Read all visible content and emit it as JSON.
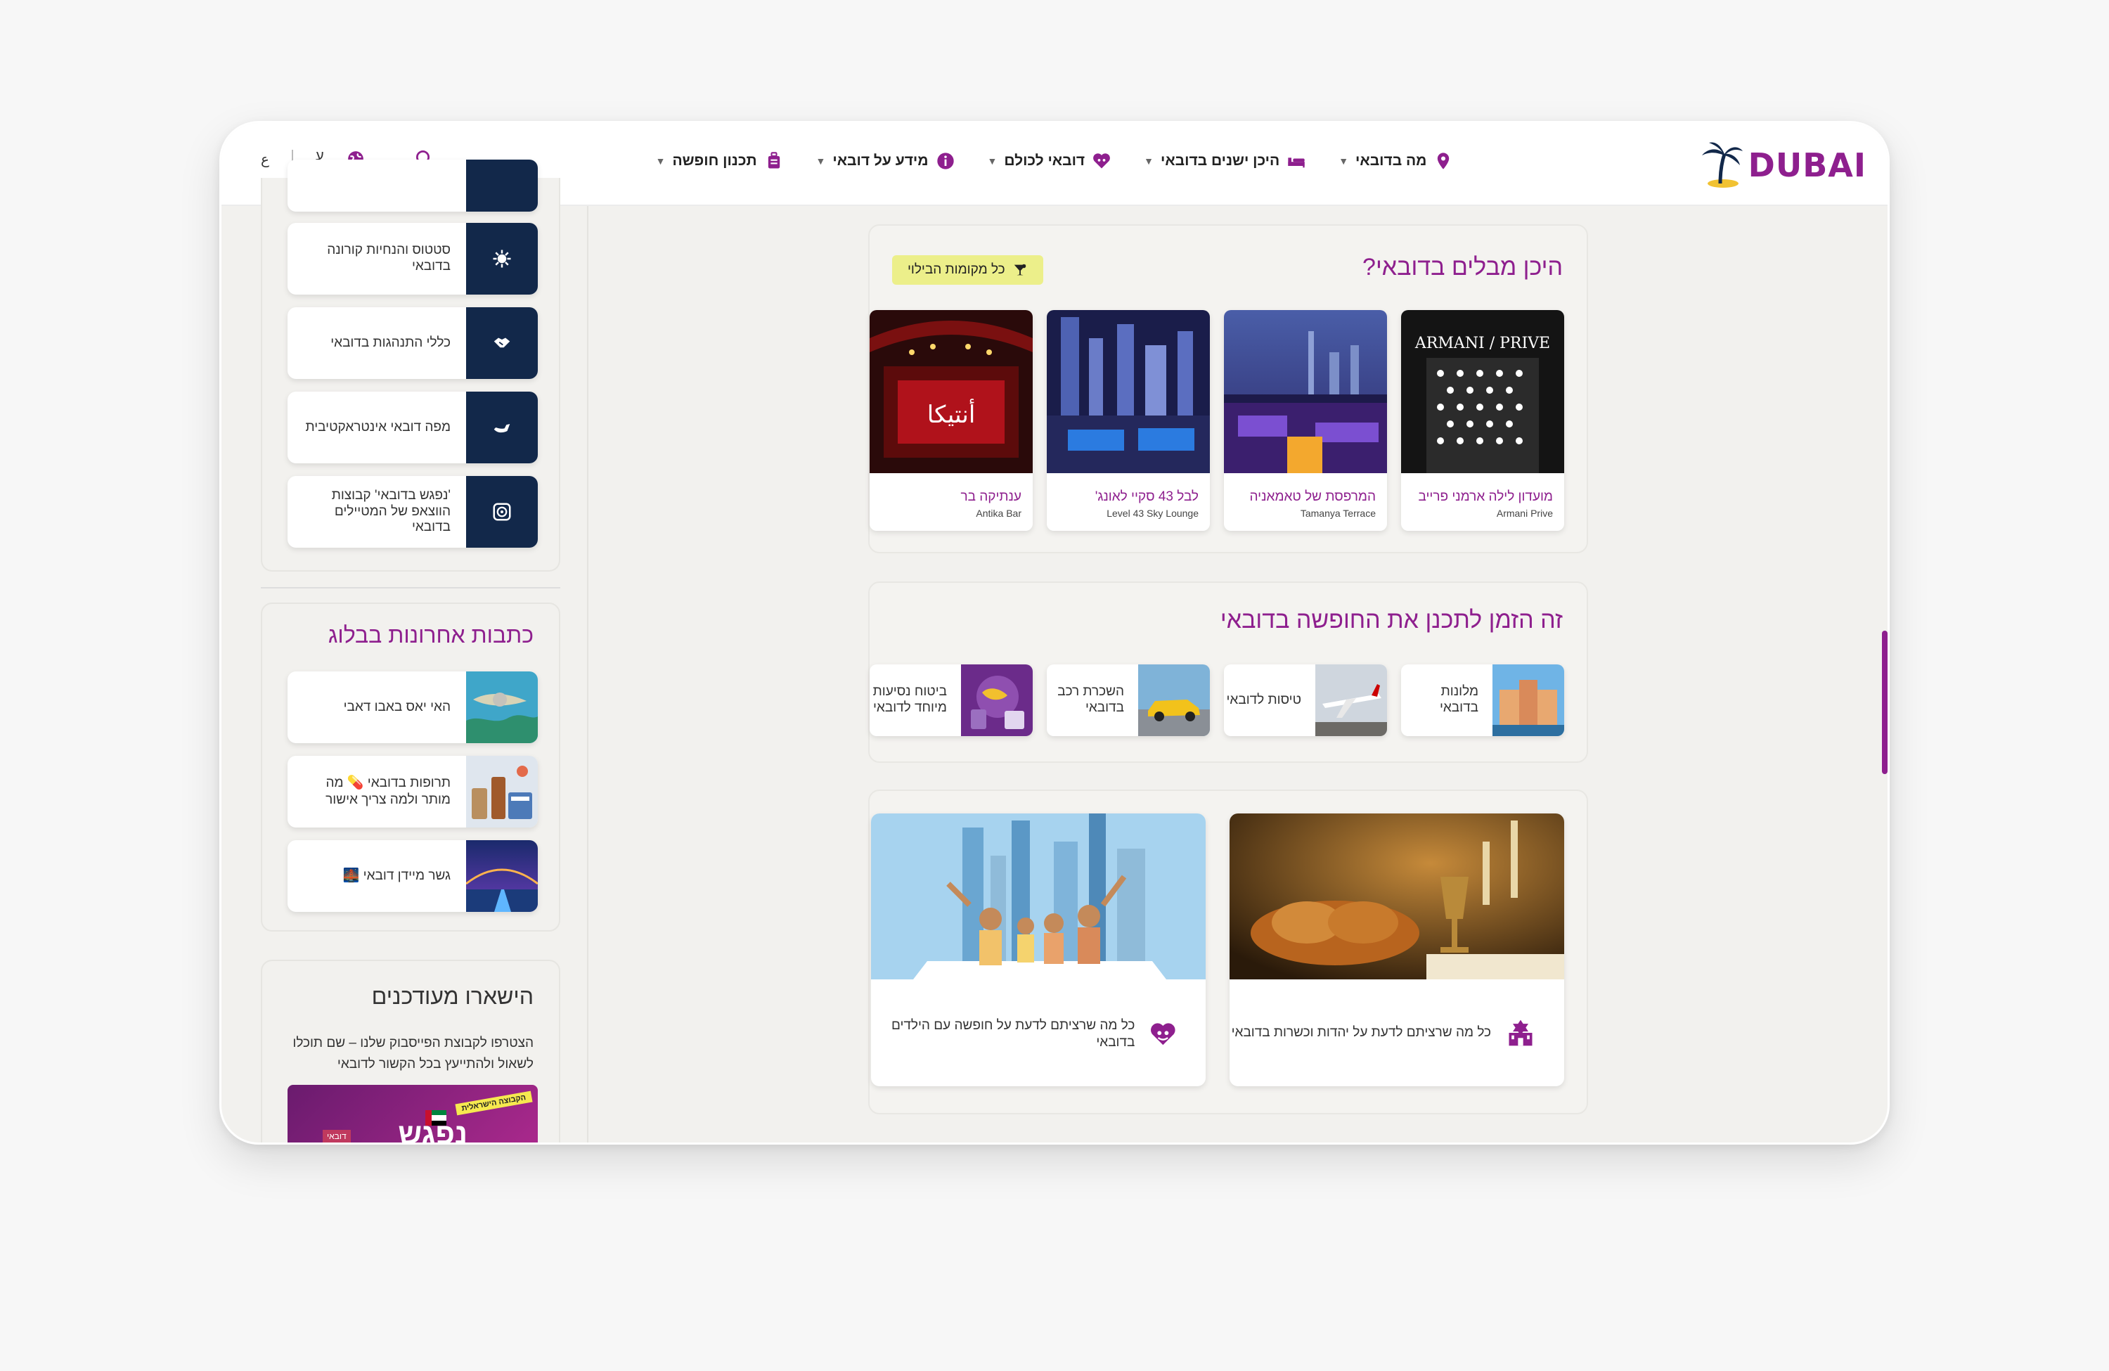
{
  "header": {
    "logo_text": "DUBAI",
    "nav": [
      {
        "label": "מה בדובאי",
        "icon": "map-pin-icon"
      },
      {
        "label": "היכן ישנים בדובאי",
        "icon": "bed-icon"
      },
      {
        "label": "דובאי לכולם",
        "icon": "heart-people-icon"
      },
      {
        "label": "מידע על דובאי",
        "icon": "info-icon"
      },
      {
        "label": "תכנון חופשה",
        "icon": "luggage-icon"
      }
    ],
    "lang_he": "ע",
    "lang_ar": "ع"
  },
  "sidebar": {
    "links": [
      {
        "label": "סטטוס והנחיות קורונה בדובאי",
        "icon": "virus-icon"
      },
      {
        "label": "כללי התנהגות בדובאי",
        "icon": "handshake-icon"
      },
      {
        "label": "מפה דובאי אינטראקטיבית",
        "icon": "map-icon"
      },
      {
        "label": "'נפגש בדובאי' קבוצות הווצאפ של המטיילים בדובאי",
        "icon": "whatsapp-icon"
      }
    ],
    "blog_title": "כתבות אחרונות בבלוג",
    "blog_posts": [
      {
        "label": "האי יאס באבו דאבי"
      },
      {
        "label": "תרופות בדובאי 💊 מה מותר ולמה צריך אישור"
      },
      {
        "label": "גשר מיידן דובאי 🌉"
      }
    ],
    "updates_title": "הישארו מעודכנים",
    "updates_text": "הצטרפו לקבוצת הפייסבוק שלנו – שם תוכלו לשאול ולהתייעץ בכל הקשור לדובאי",
    "banner_text": "נפגש",
    "banner_sub": "דובאי",
    "banner_ribbon": "הקבוצה הישראלית"
  },
  "nightlife": {
    "title": "היכן מבלים בדובאי?",
    "badge": "כל מקומות הבילוי",
    "venues": [
      {
        "he": "מועדון לילה ארמני פרייב",
        "en": "Armani Prive",
        "sign": "ARMANI / PRIVE"
      },
      {
        "he": "המרפסת של טאמאניה",
        "en": "Tamanya Terrace"
      },
      {
        "he": "לבל 43 סקיי לאונג'",
        "en": "Level 43 Sky Lounge"
      },
      {
        "he": "ענתיקה בר",
        "en": "Antika Bar"
      }
    ]
  },
  "planning": {
    "title": "זה הזמן לתכנן את החופשה בדובאי",
    "items": [
      {
        "label": "מלונות בדובאי"
      },
      {
        "label": "טיסות לדובאי"
      },
      {
        "label": "השכרת רכב בדובאי"
      },
      {
        "label": "ביטוח נסיעות מיוחד לדובאי"
      }
    ]
  },
  "features": [
    {
      "label": "כל מה שרציתם לדעת על יהדות וכשרות בדובאי",
      "icon": "synagogue-icon"
    },
    {
      "label": "כל מה שרציתם לדעת על חופשה עם הילדים בדובאי",
      "icon": "heart-family-icon"
    }
  ],
  "colors": {
    "brand": "#8e1f8e",
    "navy": "#12284a",
    "badge": "#ecef8a"
  }
}
